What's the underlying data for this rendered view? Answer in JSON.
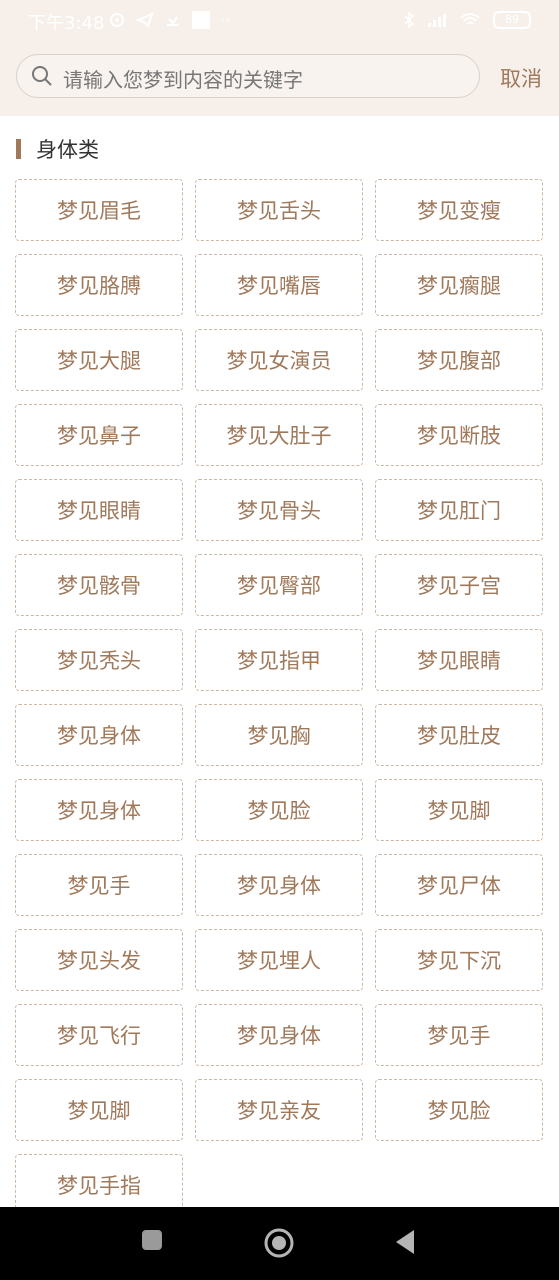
{
  "status_bar": {
    "time": "下午3:48",
    "extra": "··",
    "battery": "89"
  },
  "search": {
    "placeholder": "请输入您梦到内容的关键字",
    "cancel_label": "取消"
  },
  "section": {
    "title": "身体类"
  },
  "items": [
    "梦见眉毛",
    "梦见舌头",
    "梦见变瘦",
    "梦见胳膊",
    "梦见嘴唇",
    "梦见瘸腿",
    "梦见大腿",
    "梦见女演员",
    "梦见腹部",
    "梦见鼻子",
    "梦见大肚子",
    "梦见断肢",
    "梦见眼睛",
    "梦见骨头",
    "梦见肛门",
    "梦见骸骨",
    "梦见臀部",
    "梦见子宫",
    "梦见秃头",
    "梦见指甲",
    "梦见眼睛",
    "梦见身体",
    "梦见胸",
    "梦见肚皮",
    "梦见身体",
    "梦见脸",
    "梦见脚",
    "梦见手",
    "梦见身体",
    "梦见尸体",
    "梦见头发",
    "梦见埋人",
    "梦见下沉",
    "梦见飞行",
    "梦见身体",
    "梦见手",
    "梦见脚",
    "梦见亲友",
    "梦见脸",
    "梦见手指"
  ],
  "colors": {
    "accent": "#a0785a",
    "header_bg": "#f7f0ea",
    "chip_border": "#c9b8a6"
  },
  "nav": {
    "icons": [
      "recent-apps-icon",
      "home-icon",
      "back-icon"
    ]
  }
}
